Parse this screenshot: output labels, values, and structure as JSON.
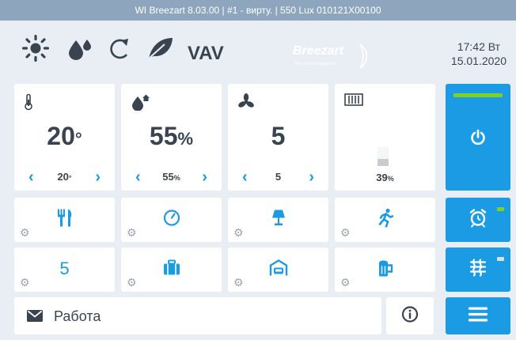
{
  "window_title": "WI Breezart 8.03.00 | #1 - вирту. | 550 Lux 010121X00100",
  "top_bar": {
    "icons": [
      "sun-icon",
      "humidity-icon",
      "recirculation-icon",
      "leaf-icon"
    ],
    "vav_label": "VAV",
    "logo": {
      "text": "Breezart",
      "tagline": "The art of air treatment"
    },
    "clock": {
      "time": "17:42 Вт",
      "date": "15.01.2020"
    }
  },
  "cards": {
    "temperature": {
      "icon": "thermometer-icon",
      "value": "20",
      "unit": "°",
      "setpoint": "20",
      "setpoint_unit": "°"
    },
    "humidity": {
      "icon": "humidity-home-icon",
      "value": "55",
      "unit": "%",
      "setpoint": "55",
      "setpoint_unit": "%"
    },
    "fan_speed": {
      "icon": "fan-icon",
      "value": "5",
      "setpoint": "5"
    },
    "filter": {
      "icon": "filter-icon",
      "level_percent": 39,
      "label": "39",
      "label_unit": "%"
    }
  },
  "scene_tiles": [
    [
      "restaurant-icon",
      "timer-icon",
      "lamp-icon",
      "running-icon"
    ],
    [
      "5",
      "suitcase-icon",
      "garage-icon",
      "beer-icon"
    ]
  ],
  "side_buttons": {
    "power": {
      "icon": "power-icon",
      "status_color": "#7ed321"
    },
    "alarm": {
      "icon": "alarm-clock-icon",
      "indicator_color": "#7ed321"
    },
    "mode": {
      "icon": "radiator-icon",
      "indicator_color": "#d8e0e8"
    },
    "menu": {
      "icon": "menu-icon"
    }
  },
  "message": {
    "icon": "envelope-icon",
    "text": "Работа"
  },
  "colors": {
    "accent": "#1a9be3",
    "ok": "#7ed321",
    "text": "#3a4450",
    "background": "#e9eef4"
  }
}
